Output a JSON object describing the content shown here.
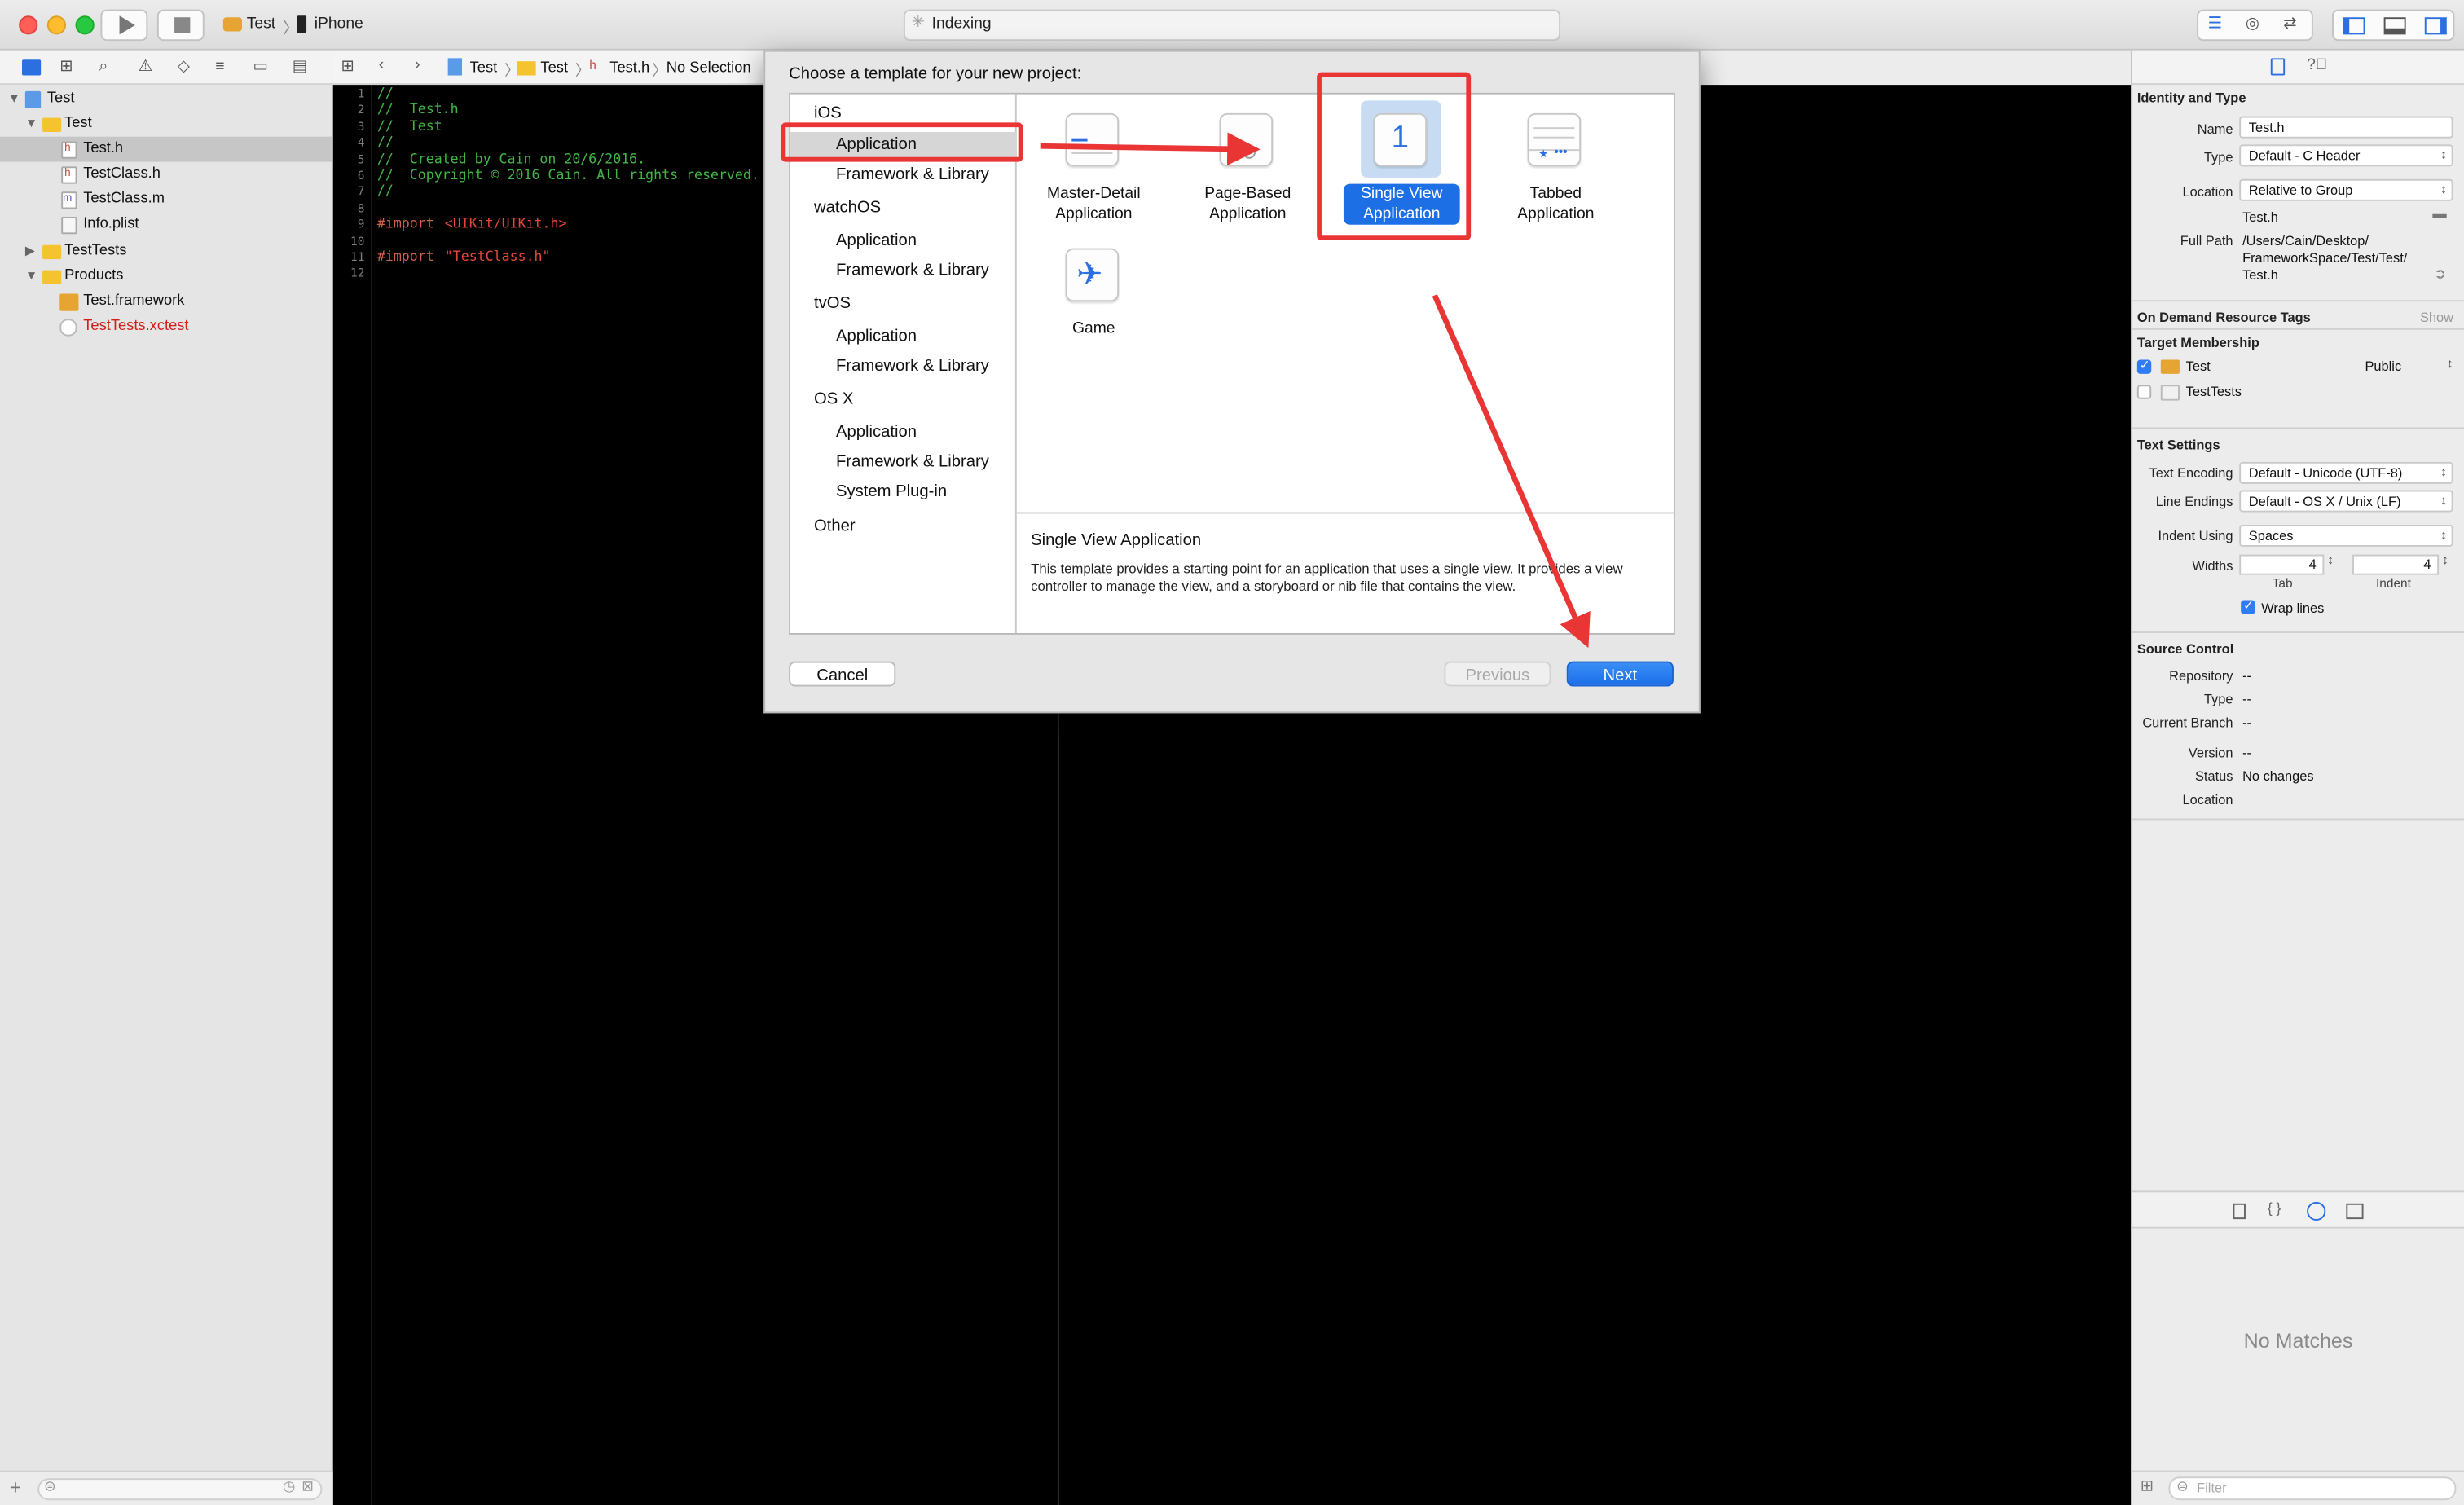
{
  "toolbar": {
    "scheme": "Test",
    "device": "iPhone",
    "activity": "Indexing"
  },
  "navigator": {
    "items": [
      {
        "label": "Test"
      },
      {
        "label": "Test"
      },
      {
        "label": "Test.h"
      },
      {
        "label": "TestClass.h"
      },
      {
        "label": "TestClass.m"
      },
      {
        "label": "Info.plist"
      },
      {
        "label": "TestTests"
      },
      {
        "label": "Products"
      },
      {
        "label": "Test.framework"
      },
      {
        "label": "TestTests.xctest"
      }
    ],
    "file_badges": {
      "h": "h",
      "m": "m"
    }
  },
  "jumpbar": {
    "crumbs": [
      "Test",
      "Test",
      "Test.h",
      "No Selection"
    ]
  },
  "editor": {
    "line_numbers": [
      "1",
      "2",
      "3",
      "4",
      "5",
      "6",
      "7",
      "8",
      "9",
      "10",
      "11",
      "12"
    ],
    "lines": {
      "l1": "//",
      "l2": "//  Test.h",
      "l3": "//  Test",
      "l4": "//",
      "l5": "//  Created by Cain on 20/6/2016.",
      "l6": "//  Copyright © 2016 Cain. All rights reserved.",
      "l7": "//",
      "l9_kw": "#import",
      "l9_path": "<UIKit/UIKit.h>",
      "l11_kw": "#import",
      "l11_path": "\"TestClass.h\""
    }
  },
  "sheet": {
    "title": "Choose a template for your new project:",
    "platforms": [
      {
        "label": "iOS"
      },
      {
        "label": "Application"
      },
      {
        "label": "Framework & Library"
      },
      {
        "label": "watchOS"
      },
      {
        "label": "Application"
      },
      {
        "label": "Framework & Library"
      },
      {
        "label": "tvOS"
      },
      {
        "label": "Application"
      },
      {
        "label": "Framework & Library"
      },
      {
        "label": "OS X"
      },
      {
        "label": "Application"
      },
      {
        "label": "Framework & Library"
      },
      {
        "label": "System Plug-in"
      },
      {
        "label": "Other"
      }
    ],
    "templates": [
      {
        "line1": "Master-Detail",
        "line2": "Application"
      },
      {
        "line1": "Page-Based",
        "line2": "Application"
      },
      {
        "line1": "Single View",
        "line2": "Application",
        "icon_text": "1"
      },
      {
        "line1": "Tabbed",
        "line2": "Application"
      },
      {
        "line1": "Game",
        "line2": ""
      }
    ],
    "description_title": "Single View Application",
    "description_body": "This template provides a starting point for an application that uses a single view. It provides a view controller to manage the view, and a storyboard or nib file that contains the view.",
    "cancel": "Cancel",
    "previous": "Previous",
    "next": "Next"
  },
  "inspector": {
    "identity_header": "Identity and Type",
    "name_label": "Name",
    "name_value": "Test.h",
    "type_label": "Type",
    "type_value": "Default - C Header",
    "location_label": "Location",
    "location_value": "Relative to Group",
    "location_file": "Test.h",
    "fullpath_label": "Full Path",
    "fullpath_lines": [
      "/Users/Cain/Desktop/",
      "FrameworkSpace/Test/Test/",
      "Test.h"
    ],
    "odr_header": "On Demand Resource Tags",
    "odr_show": "Show",
    "membership_header": "Target Membership",
    "membership": [
      {
        "name": "Test",
        "visibility": "Public",
        "checked": true
      },
      {
        "name": "TestTests",
        "visibility": "",
        "checked": false
      }
    ],
    "text_header": "Text Settings",
    "encoding_label": "Text Encoding",
    "encoding_value": "Default - Unicode (UTF-8)",
    "endings_label": "Line Endings",
    "endings_value": "Default - OS X / Unix (LF)",
    "indent_label": "Indent Using",
    "indent_value": "Spaces",
    "widths_label": "Widths",
    "tab_value": "4",
    "indent_width_value": "4",
    "tab_caption": "Tab",
    "indent_caption": "Indent",
    "wrap_label": "Wrap lines",
    "source_header": "Source Control",
    "repo_label": "Repository",
    "repo_value": "--",
    "sc_type_label": "Type",
    "sc_type_value": "--",
    "branch_label": "Current Branch",
    "branch_value": "--",
    "version_label": "Version",
    "version_value": "--",
    "status_label": "Status",
    "status_value": "No changes",
    "sc_location_label": "Location",
    "no_matches": "No Matches",
    "filter_placeholder": "Filter"
  },
  "colors": {
    "accent": "#1d6fe6",
    "annotation": "#ea3535",
    "comment": "#41b645",
    "import": "#d2604a"
  }
}
